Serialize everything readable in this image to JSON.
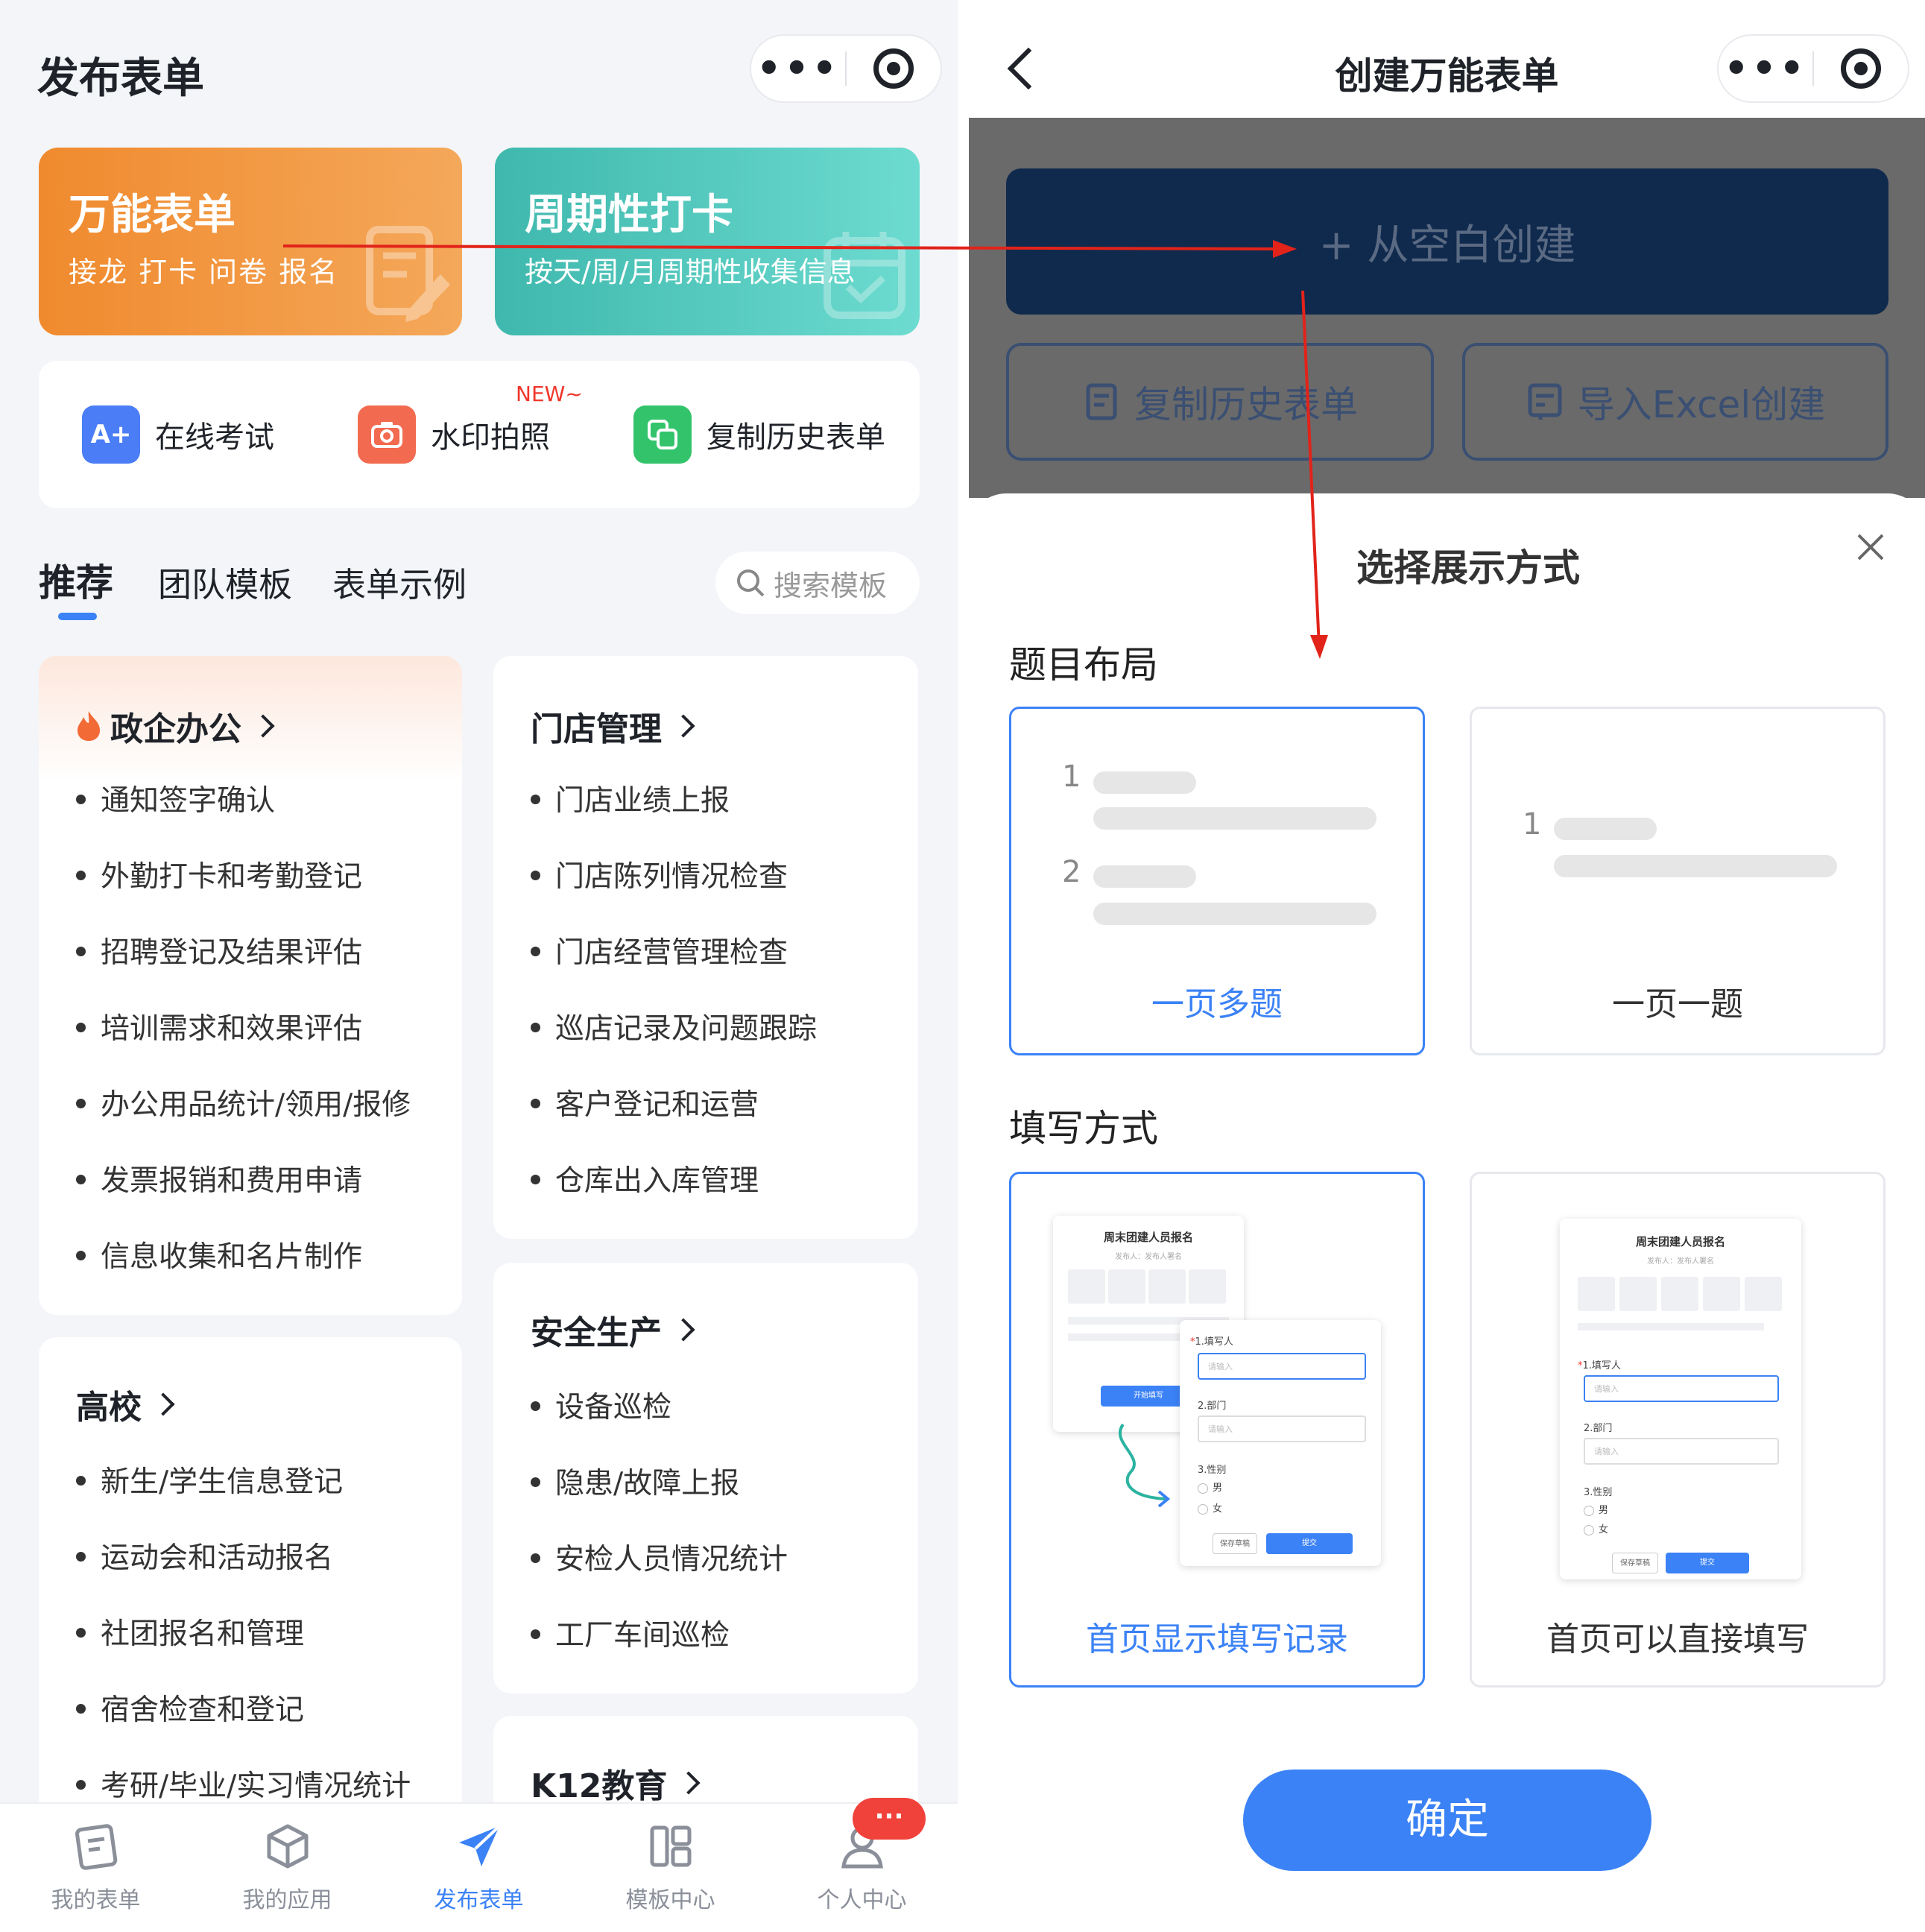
{
  "left": {
    "title": "发布表单",
    "hero": [
      {
        "title": "万能表单",
        "subtitle": "接龙 打卡 问卷 报名",
        "color_from": "#f08a2e",
        "color_to": "#f4a85a"
      },
      {
        "title": "周期性打卡",
        "subtitle": "按天/周/月周期性收集信息",
        "color_from": "#3fb8ad",
        "color_to": "#6ddbd0"
      }
    ],
    "quick": [
      {
        "label": "在线考试",
        "icon": "exam-icon",
        "color": "#4a7df6"
      },
      {
        "label": "水印拍照",
        "icon": "camera-icon",
        "color": "#f26a4f",
        "badge": "NEW~"
      },
      {
        "label": "复制历史表单",
        "icon": "copy-icon",
        "color": "#33c46b"
      }
    ],
    "tabs": [
      "推荐",
      "团队模板",
      "表单示例"
    ],
    "search_placeholder": "搜索模板",
    "categories": {
      "gov": {
        "title": "政企办公",
        "items": [
          "通知签字确认",
          "外勤打卡和考勤登记",
          "招聘登记及结果评估",
          "培训需求和效果评估",
          "办公用品统计/领用/报修",
          "发票报销和费用申请",
          "信息收集和名片制作"
        ]
      },
      "store": {
        "title": "门店管理",
        "items": [
          "门店业绩上报",
          "门店陈列情况检查",
          "门店经营管理检查",
          "巡店记录及问题跟踪",
          "客户登记和运营",
          "仓库出入库管理"
        ]
      },
      "college": {
        "title": "高校",
        "items": [
          "新生/学生信息登记",
          "运动会和活动报名",
          "社团报名和管理",
          "宿舍检查和登记",
          "考研/毕业/实习情况统计"
        ]
      },
      "safety": {
        "title": "安全生产",
        "items": [
          "设备巡检",
          "隐患/故障上报",
          "安检人员情况统计",
          "工厂车间巡检"
        ]
      },
      "k12": {
        "title": "K12教育"
      }
    },
    "nav": [
      {
        "label": "我的表单",
        "icon": "form-icon"
      },
      {
        "label": "我的应用",
        "icon": "cube-icon"
      },
      {
        "label": "发布表单",
        "icon": "send-icon",
        "active": true
      },
      {
        "label": "模板中心",
        "icon": "template-icon"
      },
      {
        "label": "个人中心",
        "icon": "user-icon",
        "badge": "···"
      }
    ],
    "nav_active_color": "#3b82f6"
  },
  "right": {
    "title": "创建万能表单",
    "create_blank": "+ 从空白创建",
    "copy_history": "复制历史表单",
    "import_excel": "导入Excel创建",
    "sheet_title": "选择展示方式",
    "layout_section": "题目布局",
    "layout_options": [
      {
        "label": "一页多题",
        "selected": true,
        "nums": [
          "1",
          "2"
        ]
      },
      {
        "label": "一页一题",
        "selected": false,
        "nums": [
          "1"
        ]
      }
    ],
    "fill_section": "填写方式",
    "fill_options": [
      {
        "label": "首页显示填写记录",
        "selected": true
      },
      {
        "label": "首页可以直接填写",
        "selected": false
      }
    ],
    "preview": {
      "title": "周末团建人员报名",
      "publisher": "发布人：发布人署名",
      "start": "开始填写",
      "q1": "1.填写人",
      "q1_required": "*",
      "q2": "2.部门",
      "q3": "3.性别",
      "placeholder": "请输入",
      "male": "男",
      "female": "女",
      "save": "保存草稿",
      "submit": "提交"
    },
    "confirm": "确定",
    "accent": "#3b82f6"
  }
}
